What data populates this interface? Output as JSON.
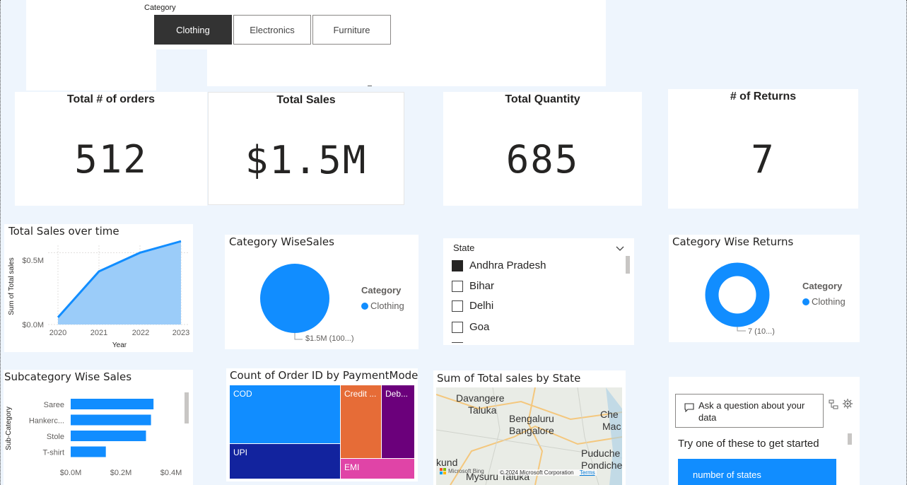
{
  "slicer": {
    "label": "Category",
    "options": [
      "Clothing",
      "Electronics",
      "Furniture"
    ],
    "selected": "Clothing"
  },
  "cards": [
    {
      "title": "Total # of orders",
      "value": "512"
    },
    {
      "title": "Total Sales",
      "value": "$1.5M"
    },
    {
      "title": "Total Quantity",
      "value": "685"
    },
    {
      "title": "# of Returns",
      "value": "7"
    }
  ],
  "sales_over_time": {
    "title": "Total Sales over time",
    "ylabel": "Sum of Total sales",
    "xlabel": "Year",
    "yticks": [
      "$0.5M",
      "$0.0M"
    ],
    "xticks": [
      "2020",
      "2021",
      "2022",
      "2023"
    ]
  },
  "category_sales": {
    "title": "Category WiseSales",
    "legend_title": "Category",
    "legend_item": "Clothing",
    "data_label": "$1.5M (100...)"
  },
  "state_slicer": {
    "title": "State",
    "items": [
      {
        "label": "Andhra Pradesh",
        "checked": true
      },
      {
        "label": "Bihar",
        "checked": false
      },
      {
        "label": "Delhi",
        "checked": false
      },
      {
        "label": "Goa",
        "checked": false
      }
    ]
  },
  "category_returns": {
    "title": "Category Wise Returns",
    "legend_title": "Category",
    "legend_item": "Clothing",
    "data_label": "7 (10...)"
  },
  "subcategory_sales": {
    "title": "Subcategory Wise Sales",
    "ylabel": "Sub-Category",
    "xticks": [
      "$0.0M",
      "$0.2M",
      "$0.4M"
    ]
  },
  "payment_mode": {
    "title": "Count of Order ID by PaymentMode",
    "tiles": [
      "COD",
      "UPI",
      "Credit ...",
      "Deb...",
      "EMI"
    ]
  },
  "map": {
    "title": "Sum of Total sales by State",
    "places": [
      "Davangere",
      "Taluka",
      "Bengaluru",
      "Bangalore",
      "Che",
      "Mac",
      "Puduche",
      "Pondiche",
      "kund",
      "Mysuru Taluka"
    ],
    "attribution": "© 2024 Microsoft Corporation",
    "terms": "Terms",
    "logo": "Microsoft Bing"
  },
  "qa": {
    "placeholder": "Ask a question about your data",
    "prompt": "Try one of these to get started",
    "suggestion": "number of states"
  },
  "colors": {
    "accent": "#118dff",
    "area_fill": "#9bccf9",
    "tree_cod": "#118dff",
    "tree_upi": "#12239e",
    "tree_credit": "#e66c37",
    "tree_debit": "#6b007b",
    "tree_emi": "#e044a7"
  },
  "chart_data": [
    {
      "type": "area",
      "title": "Total Sales over time",
      "x": [
        "2020",
        "2021",
        "2022",
        "2023"
      ],
      "series": [
        {
          "name": "Sum of Total sales",
          "values": [
            0.05,
            0.37,
            0.5,
            0.58
          ]
        }
      ],
      "xlabel": "Year",
      "ylabel": "Sum of Total sales",
      "ylim": [
        0,
        0.65
      ],
      "unit": "$M"
    },
    {
      "type": "pie",
      "title": "Category WiseSales",
      "categories": [
        "Clothing"
      ],
      "values": [
        1.5
      ],
      "unit": "$M"
    },
    {
      "type": "pie",
      "title": "Category Wise Returns",
      "categories": [
        "Clothing"
      ],
      "values": [
        7
      ]
    },
    {
      "type": "bar",
      "title": "Subcategory Wise Sales",
      "categories": [
        "Saree",
        "Hankerc...",
        "Stole",
        "T-shirt"
      ],
      "values": [
        0.33,
        0.32,
        0.3,
        0.14
      ],
      "xlim": [
        0,
        0.45
      ],
      "unit": "$M",
      "ylabel": "Sub-Category"
    }
  ]
}
